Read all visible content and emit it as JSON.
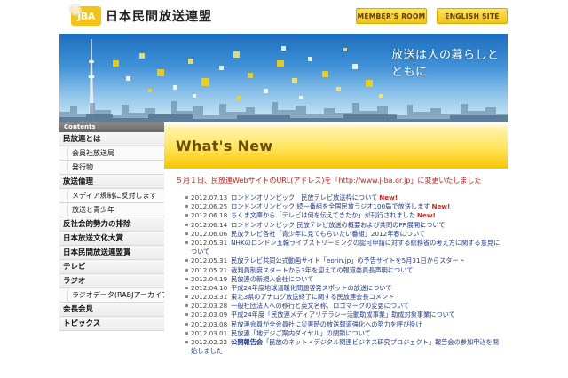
{
  "header": {
    "logo_mark": "JBA",
    "logo_text": "日本民間放送連盟",
    "member_button": "MEMBER'S ROOM",
    "english_button": "ENGLISH SITE"
  },
  "hero": {
    "tagline": "放送は人の暮らしとともに"
  },
  "sidebar": {
    "heading": "Contents",
    "items": [
      {
        "label": "民放連とは",
        "kind": "major"
      },
      {
        "label": "会員社放送局",
        "kind": "sub"
      },
      {
        "label": "発行物",
        "kind": "sub"
      },
      {
        "label": "放送倫理",
        "kind": "major"
      },
      {
        "label": "メディア規制に反対します",
        "kind": "sub"
      },
      {
        "label": "放送と青少年",
        "kind": "sub"
      },
      {
        "label": "反社会的勢力の排除",
        "kind": "major"
      },
      {
        "label": "日本放送文化大賞",
        "kind": "major"
      },
      {
        "label": "日本民間放送連盟賞",
        "kind": "major"
      },
      {
        "label": "テレビ",
        "kind": "major"
      },
      {
        "label": "ラジオ",
        "kind": "major"
      },
      {
        "label": "ラジオデータ(RABJアーカイブ)",
        "kind": "sub"
      },
      {
        "label": "会長会見",
        "kind": "major"
      },
      {
        "label": "トピックス",
        "kind": "major"
      }
    ]
  },
  "main": {
    "title": "What's New",
    "notice": "５月１日、民放連WebサイトのURL(アドレス)を「http://www.j-ba.or.jp」に変更いたしました",
    "news": [
      {
        "date": "2012.07.13",
        "text": "ロンドンオリンピック　民放テレビ放送枠について",
        "new": "New!"
      },
      {
        "date": "2012.06.25",
        "text": "ロンドンオリンピック 続一番組を全国民放ラジオ100局で放送します",
        "new": "New!"
      },
      {
        "date": "2012.06.18",
        "text": "ちくま文庫から「テレビは何を伝えてきたか」が刊行されました",
        "new": "New!"
      },
      {
        "date": "2012.06.14",
        "text": "ロンドンオリンピック 民放テレビ放送の概要および共同のPR展開について",
        "new": ""
      },
      {
        "date": "2012.06.06",
        "text": "民放テレビ各社「青少年に見てもらいたい番組」2012年春について",
        "new": ""
      },
      {
        "date": "2012.05.31",
        "text": "NHKのロンドン五輪ライブストリーミングの認可申請に対する総務省の考え方に関する意見について",
        "new": "",
        "wrap": true
      },
      {
        "date": "2012.05.31",
        "text": "民放テレビ共同公式動画サイト「eorin.jp」の予告サイトを5月31日からスタート",
        "new": ""
      },
      {
        "date": "2012.05.21",
        "text": "裁判員制度スタートから3年を迎えての報道委員長声明について",
        "new": ""
      },
      {
        "date": "2012.04.19",
        "text": "民放連の新規入会社について",
        "new": ""
      },
      {
        "date": "2012.04.10",
        "text": "平成24年度地球温暖化問題啓発スポットの放送について",
        "new": ""
      },
      {
        "date": "2012.03.31",
        "text": "東北3県のアナログ放送終了に関する民放連会長コメント",
        "new": ""
      },
      {
        "date": "2012.03.28",
        "text": "一般社団法人への移行と英文名称、ロゴマークの変更について",
        "new": ""
      },
      {
        "date": "2012.03.09",
        "text": "平成24年度「民放連メディアリテラシー活動助成事業」助成対象事業について",
        "new": ""
      },
      {
        "date": "2012.03.08",
        "text": "民放連会員が全会員社に災害時の放送報道強化への努力を呼び掛け",
        "new": ""
      },
      {
        "date": "2012.03.01",
        "text": "民放連「地デジご案内ダイヤル」の閉鎖について",
        "new": ""
      },
      {
        "date": "2012.02.22",
        "category": "公開報告会",
        "text": "「民放のネット・デジタル関連ビジネス研究プロジェクト」報告会の参加申込を開始しました",
        "new": "",
        "wrap": true
      }
    ]
  },
  "colors": {
    "brand_yellow": "#f4c316",
    "notice_red": "#c8201b",
    "link_blue": "#1f3b8f",
    "new_red": "#e0211a"
  }
}
